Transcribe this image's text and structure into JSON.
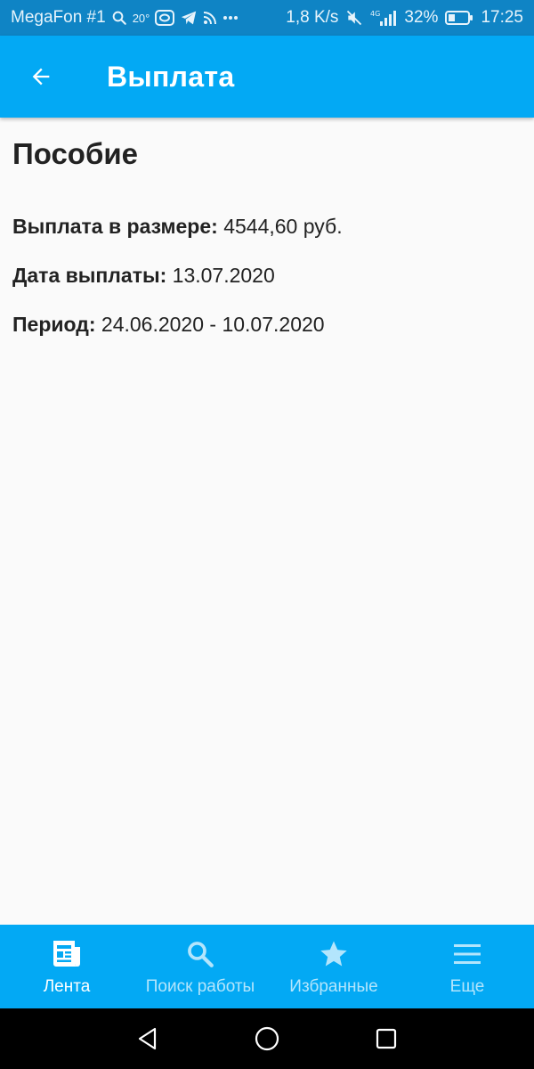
{
  "status_bar": {
    "carrier": "MegaFon #1",
    "temperature": "20°",
    "net_speed": "1,8 K/s",
    "network": "4G",
    "battery": "32%",
    "time": "17:25"
  },
  "app_bar": {
    "title": "Выплата"
  },
  "content": {
    "section_title": "Пособие",
    "rows": [
      {
        "label": "Выплата в размере:",
        "value": "4544,60 руб."
      },
      {
        "label": "Дата выплаты:",
        "value": "13.07.2020"
      },
      {
        "label": "Период:",
        "value": "24.06.2020 - 10.07.2020"
      }
    ]
  },
  "bottom_nav": {
    "items": [
      {
        "label": "Лента",
        "icon": "news-icon",
        "active": true
      },
      {
        "label": "Поиск работы",
        "icon": "search-icon",
        "active": false
      },
      {
        "label": "Избранные",
        "icon": "star-icon",
        "active": false
      },
      {
        "label": "Еще",
        "icon": "menu-icon",
        "active": false
      }
    ]
  },
  "colors": {
    "primary": "#03a9f4",
    "status_bar": "#0f84c5",
    "inactive_nav": "#b3e5fc"
  }
}
